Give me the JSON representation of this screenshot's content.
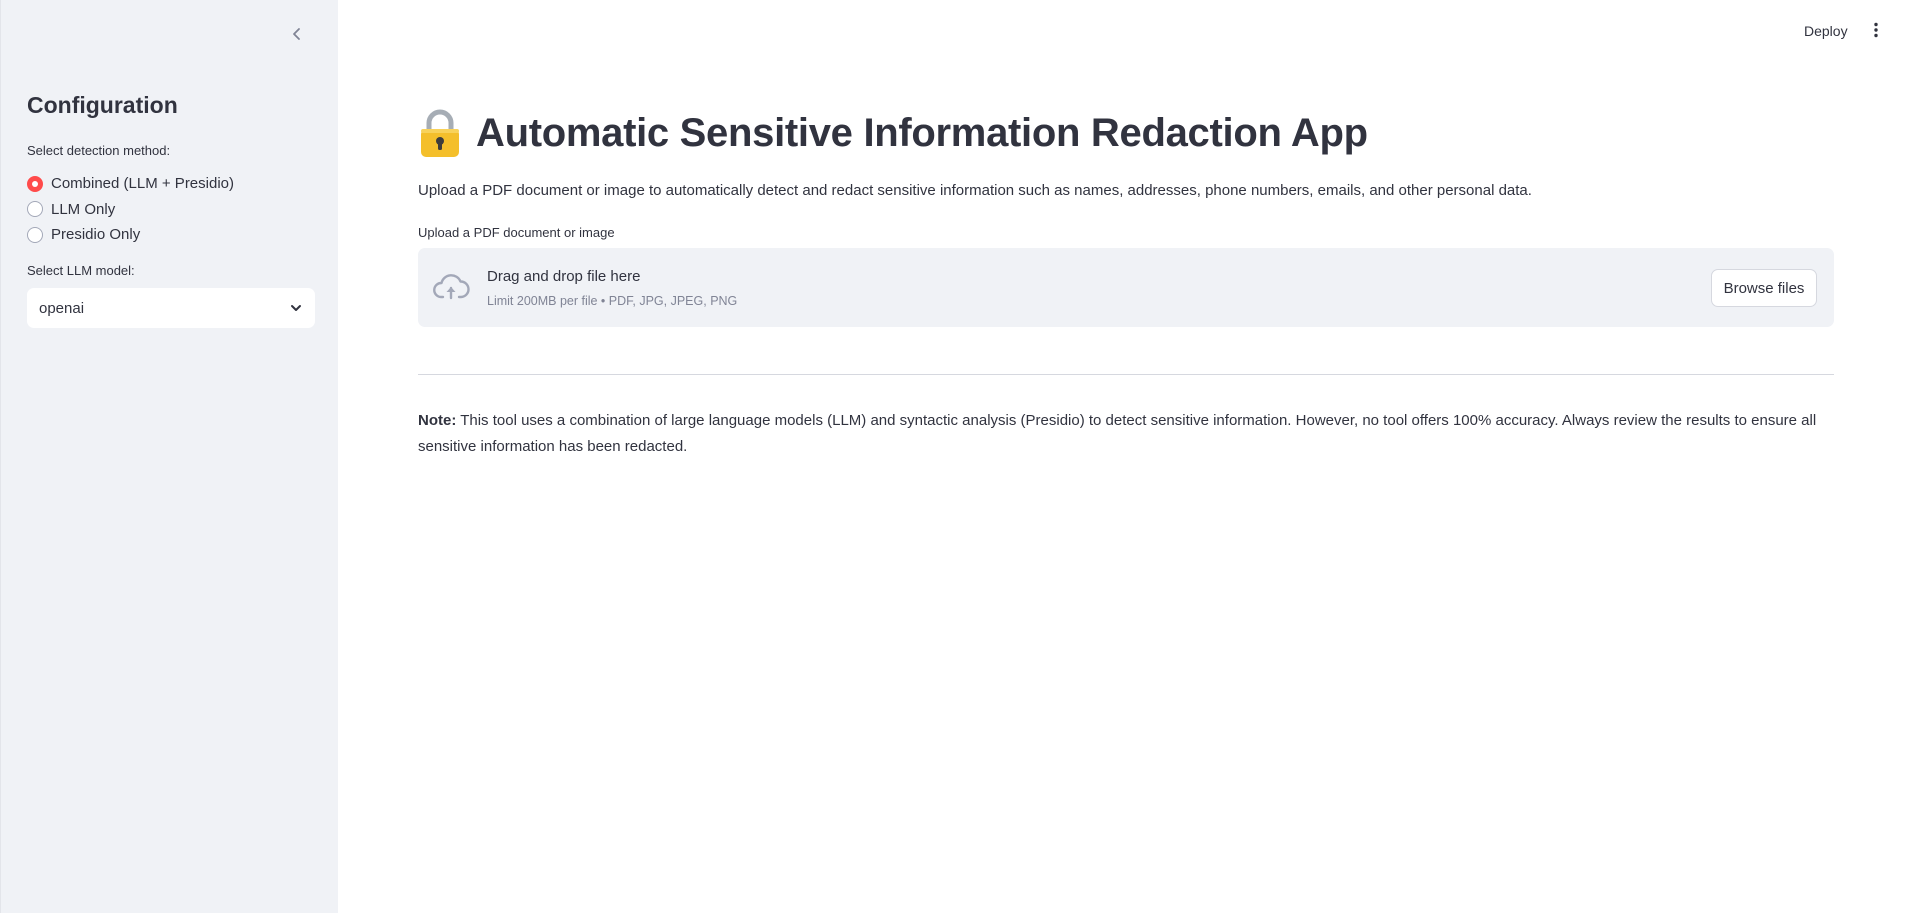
{
  "header": {
    "deploy_label": "Deploy",
    "menu_icon": "kebab-menu-icon"
  },
  "sidebar": {
    "collapse_icon": "chevron-left-icon",
    "title": "Configuration",
    "detection_label": "Select detection method:",
    "detection_options": [
      {
        "label": "Combined (LLM + Presidio)",
        "checked": true
      },
      {
        "label": "LLM Only",
        "checked": false
      },
      {
        "label": "Presidio Only",
        "checked": false
      }
    ],
    "model_label": "Select LLM model:",
    "model_value": "openai"
  },
  "main": {
    "title_icon": "lock-icon",
    "title": "Automatic Sensitive Information Redaction App",
    "description": "Upload a PDF document or image to automatically detect and redact sensitive information such as names, addresses, phone numbers, emails, and other personal data.",
    "uploader": {
      "label": "Upload a PDF document or image",
      "drop_text": "Drag and drop file here",
      "limit_text": "Limit 200MB per file • PDF, JPG, JPEG, PNG",
      "browse_label": "Browse files",
      "icon": "cloud-upload-icon"
    },
    "note": {
      "prefix": "Note:",
      "text": " This tool uses a combination of large language models (LLM) and syntactic analysis (Presidio) to detect sensitive information. However, no tool offers 100% accuracy. Always review the results to ensure all sensitive information has been redacted."
    }
  },
  "colors": {
    "accent": "#ff4b4b",
    "sidebar_bg": "#f0f2f6",
    "text": "#31333f",
    "muted": "#808495"
  }
}
